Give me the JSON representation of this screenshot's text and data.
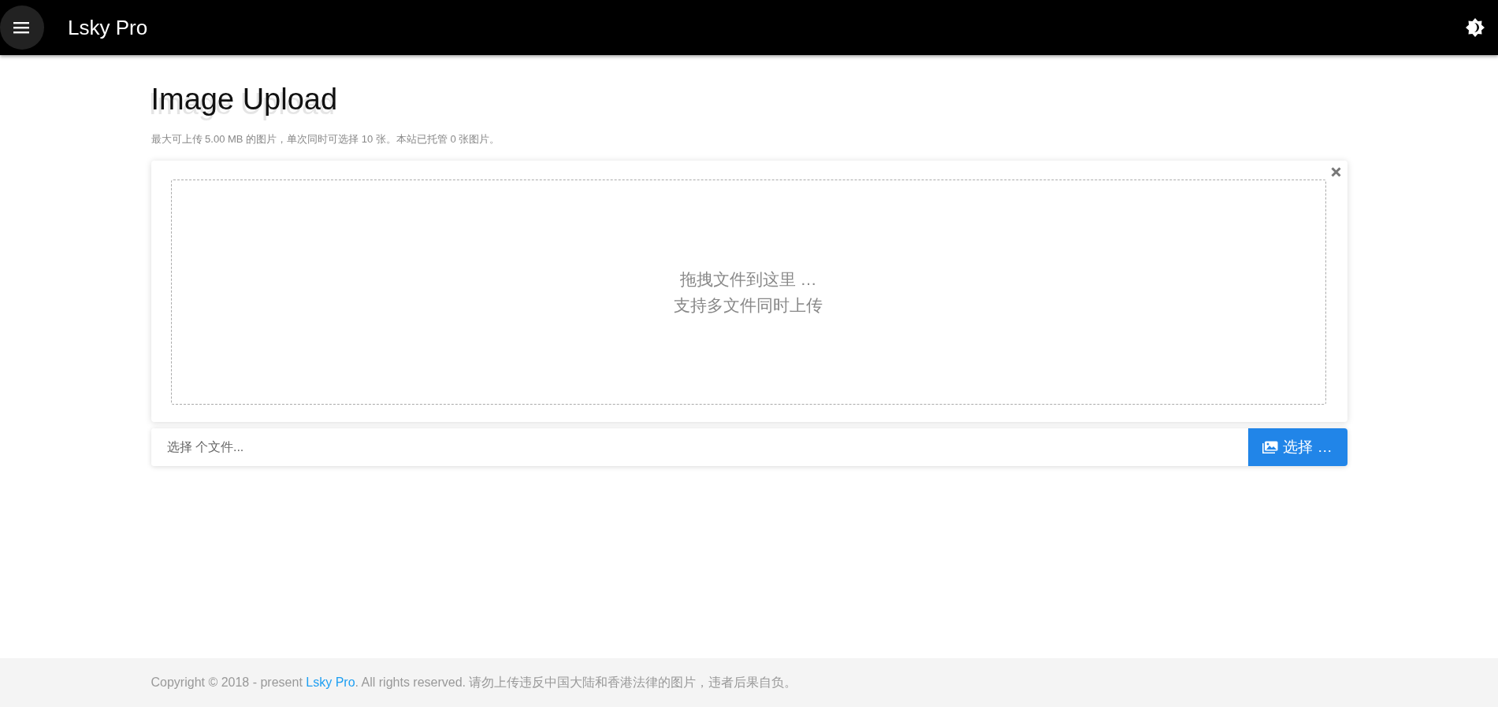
{
  "header": {
    "title": "Lsky Pro"
  },
  "page": {
    "title": "Image Upload",
    "subtitle": "最大可上传 5.00 MB 的图片，单次同时可选择 10 张。本站已托管 0 张图片。"
  },
  "dropzone": {
    "lines": [
      "拖拽文件到这里 …",
      "支持多文件同时上传"
    ]
  },
  "file_input": {
    "placeholder": "选择 个文件...",
    "button": "选择 …"
  },
  "footer": {
    "before": "Copyright © 2018 - present ",
    "link": "Lsky Pro",
    "after": ". All rights reserved. 请勿上传违反中国大陆和香港法律的图片，违者后果自负。"
  }
}
